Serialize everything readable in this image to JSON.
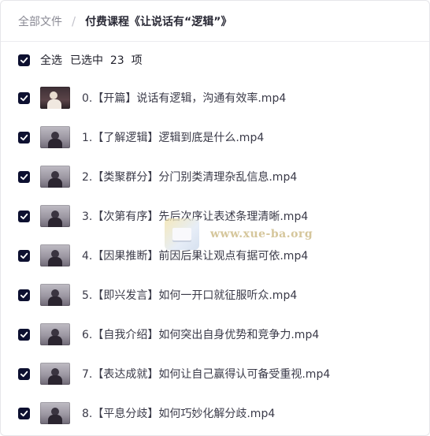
{
  "breadcrumb": {
    "root": "全部文件",
    "separator": "/",
    "current": "付费课程《让说话有“逻辑”》"
  },
  "selection": {
    "select_all_label": "全选",
    "selected_text": "已选中  23  项"
  },
  "files": [
    {
      "name": "0.【开篇】说话有逻辑，沟通有效率.mp4",
      "checked": true
    },
    {
      "name": "1.【了解逻辑】逻辑到底是什么.mp4",
      "checked": true
    },
    {
      "name": "2.【类聚群分】分门别类清理杂乱信息.mp4",
      "checked": true
    },
    {
      "name": "3.【次第有序】先后次序让表述条理清晰.mp4",
      "checked": true
    },
    {
      "name": "4.【因果推断】前因后果让观点有据可依.mp4",
      "checked": true
    },
    {
      "name": "5.【即兴发言】如何一开口就征服听众.mp4",
      "checked": true
    },
    {
      "name": "6.【自我介绍】如何突出自身优势和竞争力.mp4",
      "checked": true
    },
    {
      "name": "7.【表达成就】如何让自己赢得认可备受重视.mp4",
      "checked": true
    },
    {
      "name": "8.【平息分歧】如何巧妙化解分歧.mp4",
      "checked": true
    }
  ],
  "watermark": {
    "text": "www.xue-ba.org"
  },
  "colors": {
    "checkbox": "#0d1030",
    "text": "#3a3a48",
    "muted": "#8a8a94"
  }
}
